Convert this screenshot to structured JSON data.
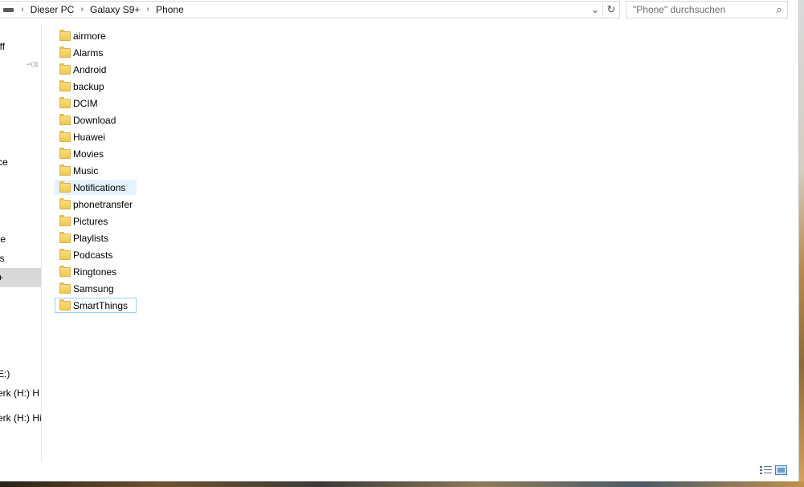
{
  "address_bar": {
    "breadcrumbs": [
      "Dieser PC",
      "Galaxy S9+",
      "Phone"
    ],
    "drive_icon": "drive-icon",
    "dropdown_icon": "chevron-down-icon",
    "refresh_icon": "refresh-icon"
  },
  "search": {
    "placeholder": "\"Phone\" durchsuchen",
    "icon": "search-icon"
  },
  "nav_pane": {
    "items": [
      {
        "label": "iff"
      },
      {
        "label": "ce"
      },
      {
        "label": "te"
      },
      {
        "label": "ls"
      },
      {
        "label": "+",
        "selected": true
      },
      {
        "label": "E:)"
      },
      {
        "label": "erk (H:) H"
      },
      {
        "label": "erk (H:) HiS"
      }
    ],
    "pin_icon": "pin-icon"
  },
  "files": [
    {
      "name": "airmore"
    },
    {
      "name": "Alarms"
    },
    {
      "name": "Android"
    },
    {
      "name": "backup"
    },
    {
      "name": "DCIM"
    },
    {
      "name": "Download"
    },
    {
      "name": "Huawei"
    },
    {
      "name": "Movies"
    },
    {
      "name": "Music"
    },
    {
      "name": "Notifications",
      "state": "hover"
    },
    {
      "name": "phonetransfer"
    },
    {
      "name": "Pictures"
    },
    {
      "name": "Playlists"
    },
    {
      "name": "Podcasts"
    },
    {
      "name": "Ringtones"
    },
    {
      "name": "Samsung"
    },
    {
      "name": "SmartThings",
      "state": "focused"
    }
  ],
  "status_bar": {
    "view_buttons": [
      "details-view-icon",
      "tiles-view-icon"
    ]
  },
  "colors": {
    "hover_bg": "#e5f3ff",
    "focus_border": "#99d1ff",
    "selected_nav_bg": "#d9d9d9",
    "folder_yellow": "#f2c94c"
  }
}
